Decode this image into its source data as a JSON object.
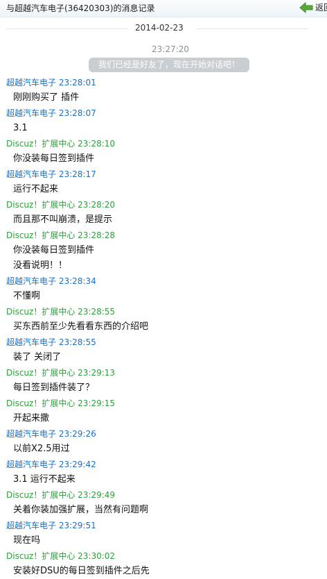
{
  "header": {
    "title": "与超越汽车电子(36420303)的消息记录",
    "back_label": "返回"
  },
  "date_separator": "2014-02-23",
  "system": {
    "time": "23:27:20",
    "notice": "我们已经是好友了，现在开始对话吧！"
  },
  "colors": {
    "self_name": "#1a6fc4",
    "other_name": "#2e9e3a",
    "back_arrow": "#5aa83a"
  },
  "messages": [
    {
      "sender": "超越汽车电子",
      "time": "23:28:01",
      "kind": "self",
      "lines": [
        "刚刚购买了 插件"
      ]
    },
    {
      "sender": "超越汽车电子",
      "time": "23:28:07",
      "kind": "self",
      "lines": [
        "3.1"
      ]
    },
    {
      "sender": "Discuz！扩展中心",
      "time": "23:28:10",
      "kind": "other",
      "lines": [
        "你没装每日签到插件"
      ]
    },
    {
      "sender": "超越汽车电子",
      "time": "23:28:17",
      "kind": "self",
      "lines": [
        "运行不起来"
      ]
    },
    {
      "sender": "Discuz！扩展中心",
      "time": "23:28:20",
      "kind": "other",
      "lines": [
        "而且那不叫崩溃，是提示"
      ]
    },
    {
      "sender": "Discuz！扩展中心",
      "time": "23:28:28",
      "kind": "other",
      "lines": [
        "你没装每日签到插件",
        "没看说明！！"
      ]
    },
    {
      "sender": "超越汽车电子",
      "time": "23:28:34",
      "kind": "self",
      "lines": [
        "不懂啊"
      ]
    },
    {
      "sender": "Discuz！扩展中心",
      "time": "23:28:55",
      "kind": "other",
      "lines": [
        "买东西前至少先看看东西的介绍吧"
      ]
    },
    {
      "sender": "超越汽车电子",
      "time": "23:28:55",
      "kind": "self",
      "lines": [
        "装了 关闭了"
      ]
    },
    {
      "sender": "Discuz！扩展中心",
      "time": "23:29:13",
      "kind": "other",
      "lines": [
        "每日签到插件装了？"
      ]
    },
    {
      "sender": "Discuz！扩展中心",
      "time": "23:29:15",
      "kind": "other",
      "lines": [
        "开起来撒"
      ]
    },
    {
      "sender": "超越汽车电子",
      "time": "23:29:26",
      "kind": "self",
      "lines": [
        "以前X2.5用过"
      ]
    },
    {
      "sender": "超越汽车电子",
      "time": "23:29:42",
      "kind": "self",
      "lines": [
        "3.1 运行不起来"
      ]
    },
    {
      "sender": "Discuz！扩展中心",
      "time": "23:29:49",
      "kind": "other",
      "lines": [
        "关着你装加强扩展，当然有问题啊"
      ]
    },
    {
      "sender": "超越汽车电子",
      "time": "23:29:51",
      "kind": "self",
      "lines": [
        "现在吗"
      ]
    },
    {
      "sender": "Discuz！扩展中心",
      "time": "23:30:02",
      "kind": "other",
      "lines": [
        "安装好DSU的每日签到插件之后先"
      ]
    }
  ]
}
